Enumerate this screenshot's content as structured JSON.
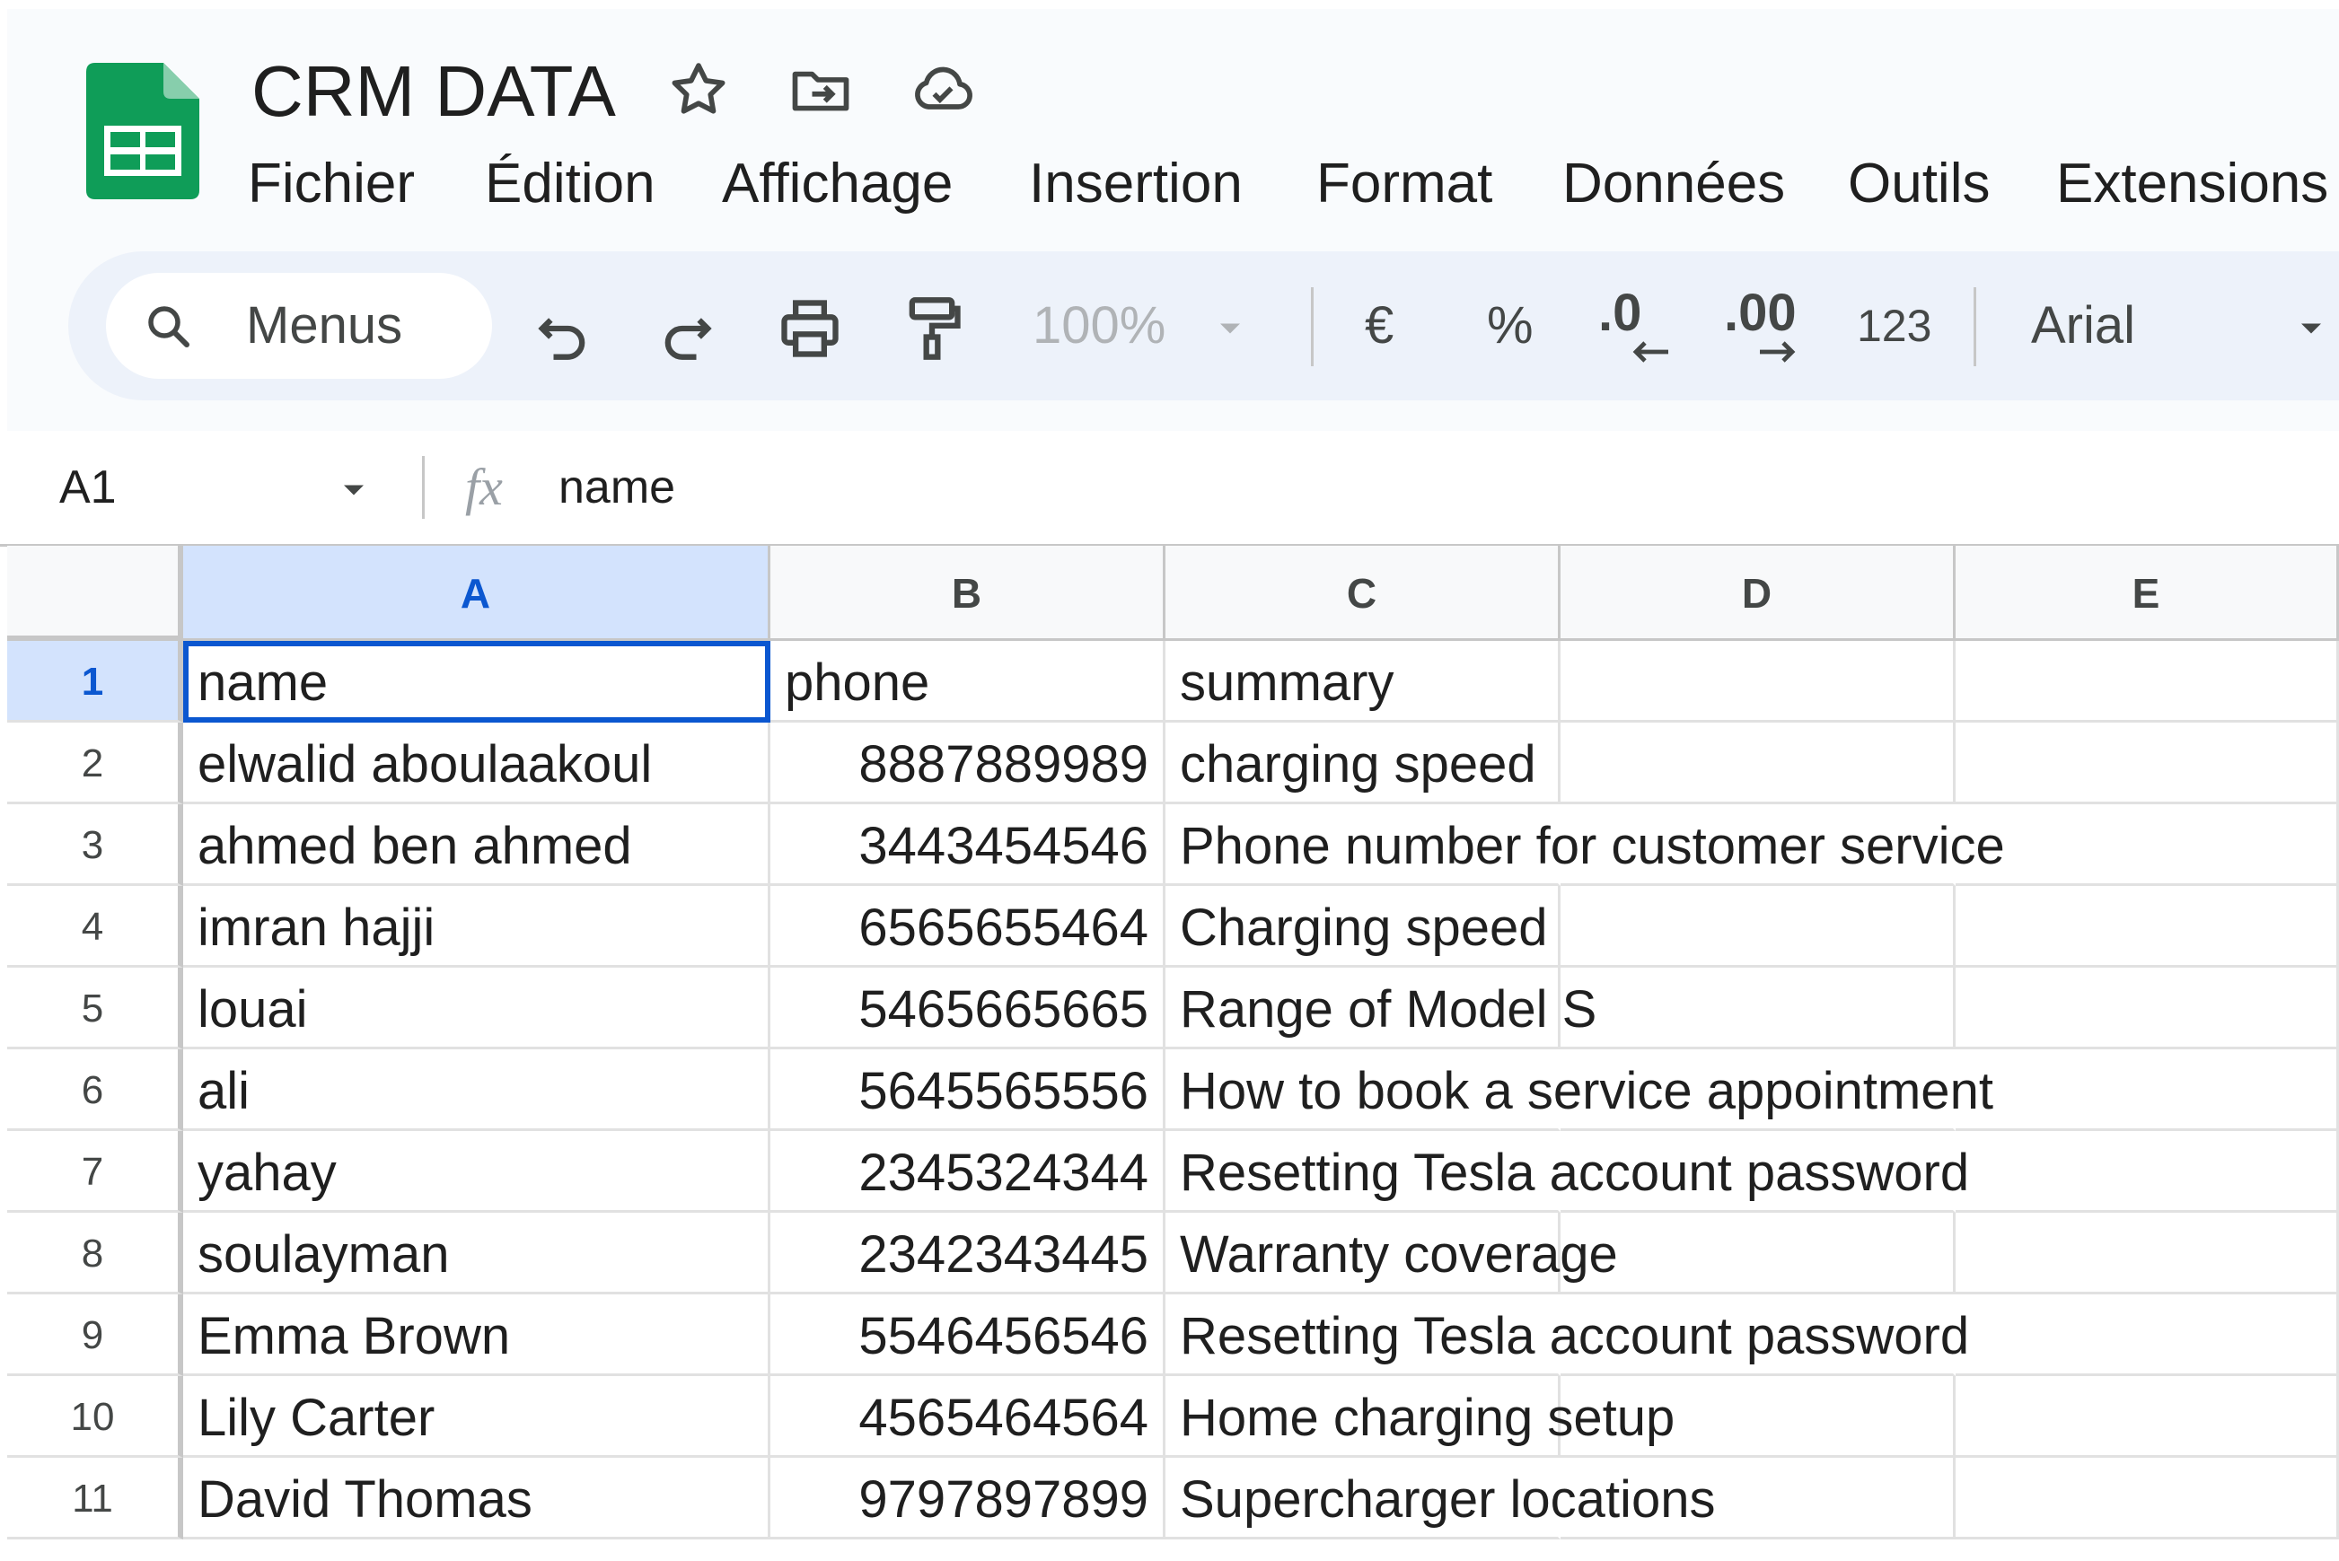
{
  "app": {
    "doc_title": "CRM DATA",
    "title_icons": [
      "star-icon",
      "move-to-folder-icon",
      "cloud-saved-icon"
    ],
    "brand_color": "#0f9d58"
  },
  "menu": {
    "items": [
      "Fichier",
      "Édition",
      "Affichage",
      "Insertion",
      "Format",
      "Données",
      "Outils",
      "Extensions"
    ]
  },
  "toolbar": {
    "search_label": "Menus",
    "zoom": "100%",
    "currency": "€",
    "percent": "%",
    "dec_decrease": ".0",
    "dec_increase": ".00",
    "number_format": "123",
    "font": "Arial",
    "icons": [
      "search-icon",
      "undo-icon",
      "redo-icon",
      "print-icon",
      "paint-format-icon",
      "chevron-down-icon"
    ]
  },
  "formula_bar": {
    "cell_ref": "A1",
    "fx": "fx",
    "value": "name"
  },
  "sheet": {
    "columns": [
      "A",
      "B",
      "C",
      "D",
      "E"
    ],
    "selected_cell": "A1",
    "selection_color": "#0b57d0",
    "rows": [
      {
        "num": "1",
        "name": "name",
        "phone": "phone",
        "summary": "summary"
      },
      {
        "num": "2",
        "name": "elwalid aboulaakoul",
        "phone": "8887889989",
        "summary": "charging speed"
      },
      {
        "num": "3",
        "name": "ahmed ben ahmed",
        "phone": "3443454546",
        "summary": "Phone number for customer service"
      },
      {
        "num": "4",
        "name": "imran hajji",
        "phone": "6565655464",
        "summary": "Charging speed"
      },
      {
        "num": "5",
        "name": "louai",
        "phone": "5465665665",
        "summary": "Range of Model S"
      },
      {
        "num": "6",
        "name": "ali",
        "phone": "5645565556",
        "summary": "How to book a service appointment"
      },
      {
        "num": "7",
        "name": "yahay",
        "phone": "2345324344",
        "summary": "Resetting Tesla account password"
      },
      {
        "num": "8",
        "name": "soulayman",
        "phone": "2342343445",
        "summary": "Warranty coverage"
      },
      {
        "num": "9",
        "name": "Emma Brown",
        "phone": "5546456546",
        "summary": "Resetting Tesla account password"
      },
      {
        "num": "10",
        "name": "Lily Carter",
        "phone": "4565464564",
        "summary": "Home charging setup"
      },
      {
        "num": "11",
        "name": "David Thomas",
        "phone": "9797897899",
        "summary": "Supercharger locations"
      }
    ]
  }
}
